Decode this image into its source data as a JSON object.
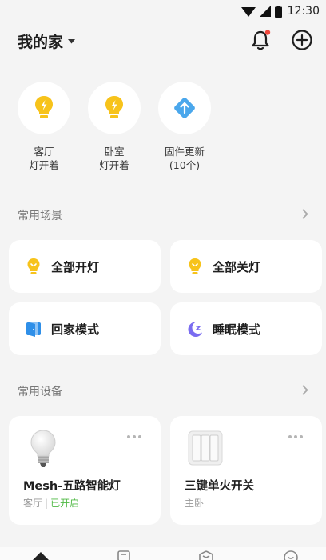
{
  "status_bar": {
    "time": "12:30",
    "icons": [
      "wifi-icon",
      "signal-icon",
      "battery-icon"
    ]
  },
  "header": {
    "home_name": "我的家",
    "bell_icon": "bell-icon",
    "add_icon": "plus-circle-icon"
  },
  "quick_status": [
    {
      "line1": "客厅",
      "line2": "灯开着",
      "icon": "bulb-icon"
    },
    {
      "line1": "卧室",
      "line2": "灯开着",
      "icon": "bulb-icon"
    },
    {
      "line1": "固件更新",
      "line2": "(10个)",
      "icon": "upload-arrow-icon"
    }
  ],
  "scenes_section": {
    "title": "常用场景"
  },
  "scenes": [
    {
      "label": "全部开灯",
      "icon": "bulb-on-icon"
    },
    {
      "label": "全部关灯",
      "icon": "bulb-off-icon"
    },
    {
      "label": "回家模式",
      "icon": "door-icon"
    },
    {
      "label": "睡眠模式",
      "icon": "moon-icon"
    }
  ],
  "devices_section": {
    "title": "常用设备"
  },
  "devices": [
    {
      "name": "Mesh-五路智能灯",
      "room": "客厅",
      "state": "已开启",
      "icon": "bulb-device-icon"
    },
    {
      "name": "三键单火开关",
      "room": "主卧",
      "icon": "switch-device-icon"
    }
  ],
  "colors": {
    "accent_yellow": "#f7c31b",
    "accent_blue": "#2f8fe8",
    "accent_purple": "#7a6cf0",
    "on_green": "#4fb944",
    "badge_red": "#f0473c"
  },
  "tabs": [
    "home-tab-icon",
    "scene-tab-icon",
    "device-tab-icon",
    "profile-tab-icon"
  ]
}
